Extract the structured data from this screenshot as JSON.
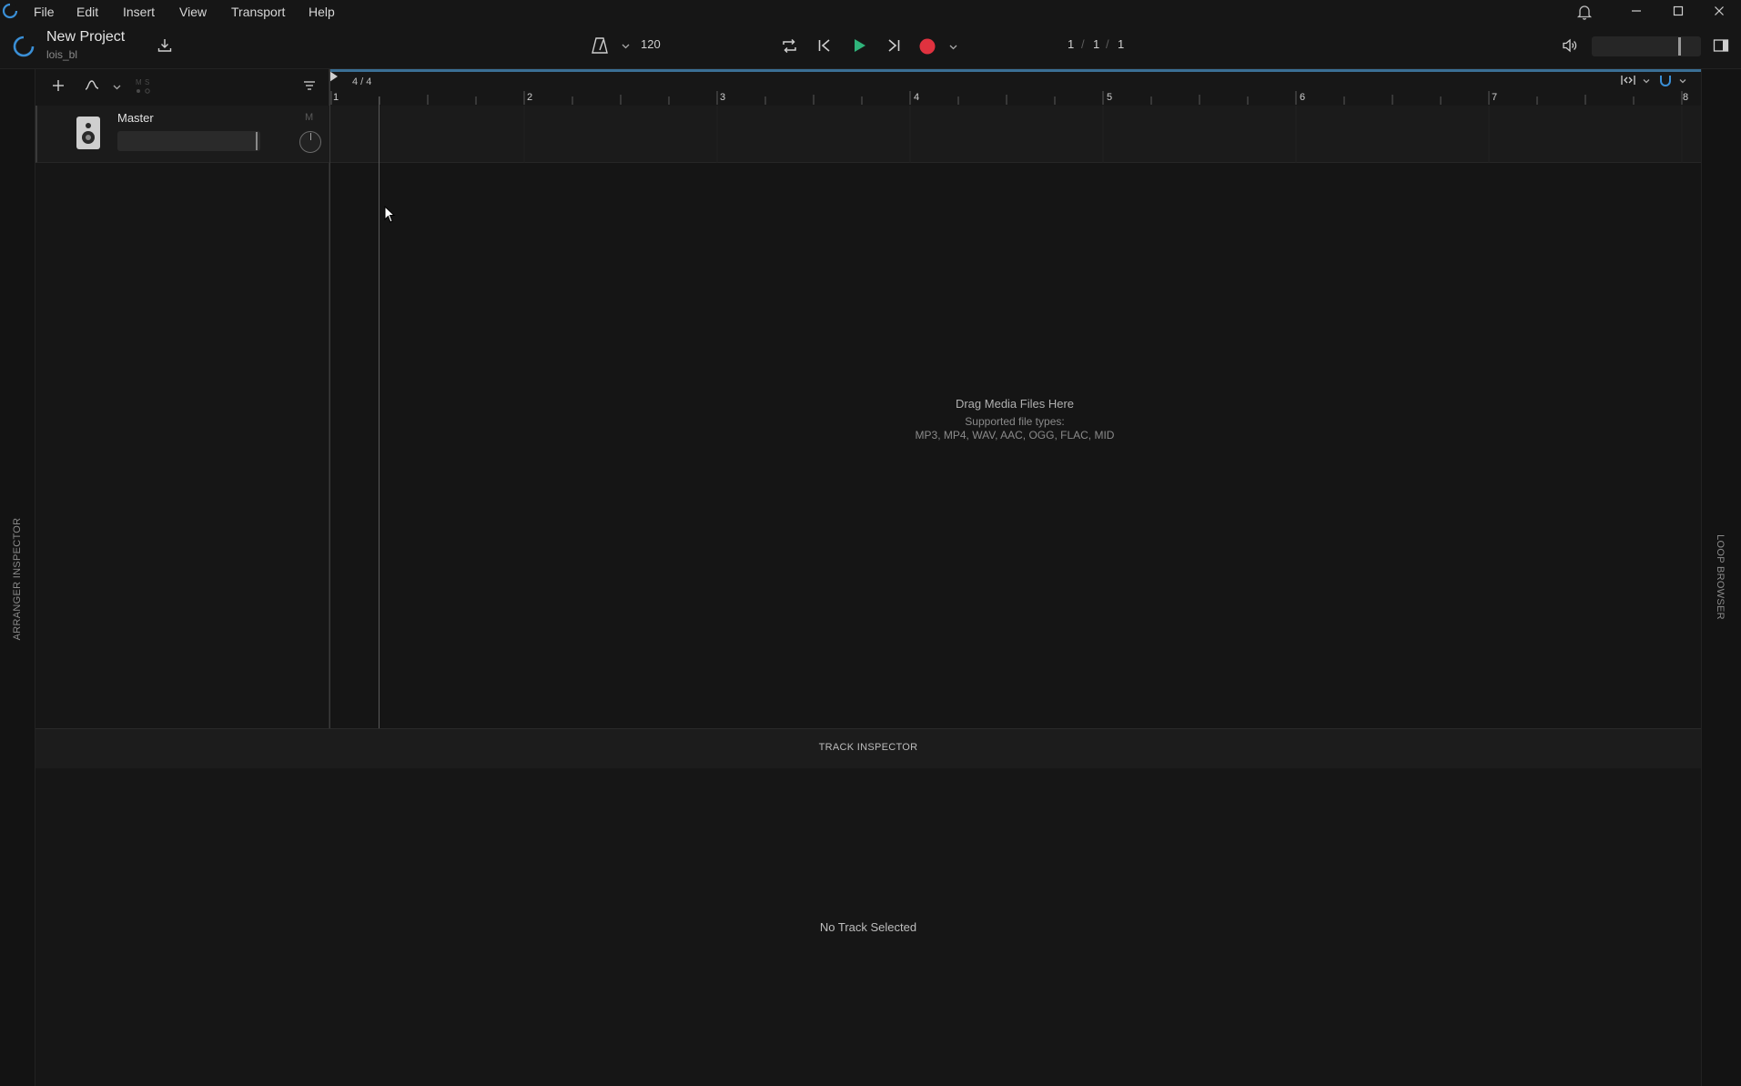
{
  "menu": {
    "items": [
      {
        "label": "File"
      },
      {
        "label": "Edit"
      },
      {
        "label": "Insert"
      },
      {
        "label": "View"
      },
      {
        "label": "Transport"
      },
      {
        "label": "Help"
      }
    ]
  },
  "header": {
    "project_title": "New Project",
    "project_owner": "lois_bl",
    "tempo": "120",
    "position": {
      "bar": "1",
      "beat": "1",
      "tick": "1",
      "separator": "/"
    }
  },
  "tracklist": {
    "master": {
      "name": "Master",
      "mute_label": "M"
    }
  },
  "arranger": {
    "time_signature": "4 / 4",
    "bars": [
      "1",
      "2",
      "3",
      "4",
      "5",
      "6",
      "7",
      "8"
    ],
    "drop_zone": {
      "title": "Drag Media Files Here",
      "subtitle": "Supported file types:",
      "types": "MP3, MP4, WAV, AAC, OGG, FLAC, MID"
    }
  },
  "side_panels": {
    "left_label": "ARRANGER INSPECTOR",
    "right_label": "LOOP BROWSER"
  },
  "inspector": {
    "title": "TRACK INSPECTOR",
    "empty_message": "No Track Selected"
  },
  "colors": {
    "accent_blue": "#3a8fd6",
    "play_green": "#2fb37a",
    "record_red": "#e0323f",
    "background": "#161616"
  }
}
